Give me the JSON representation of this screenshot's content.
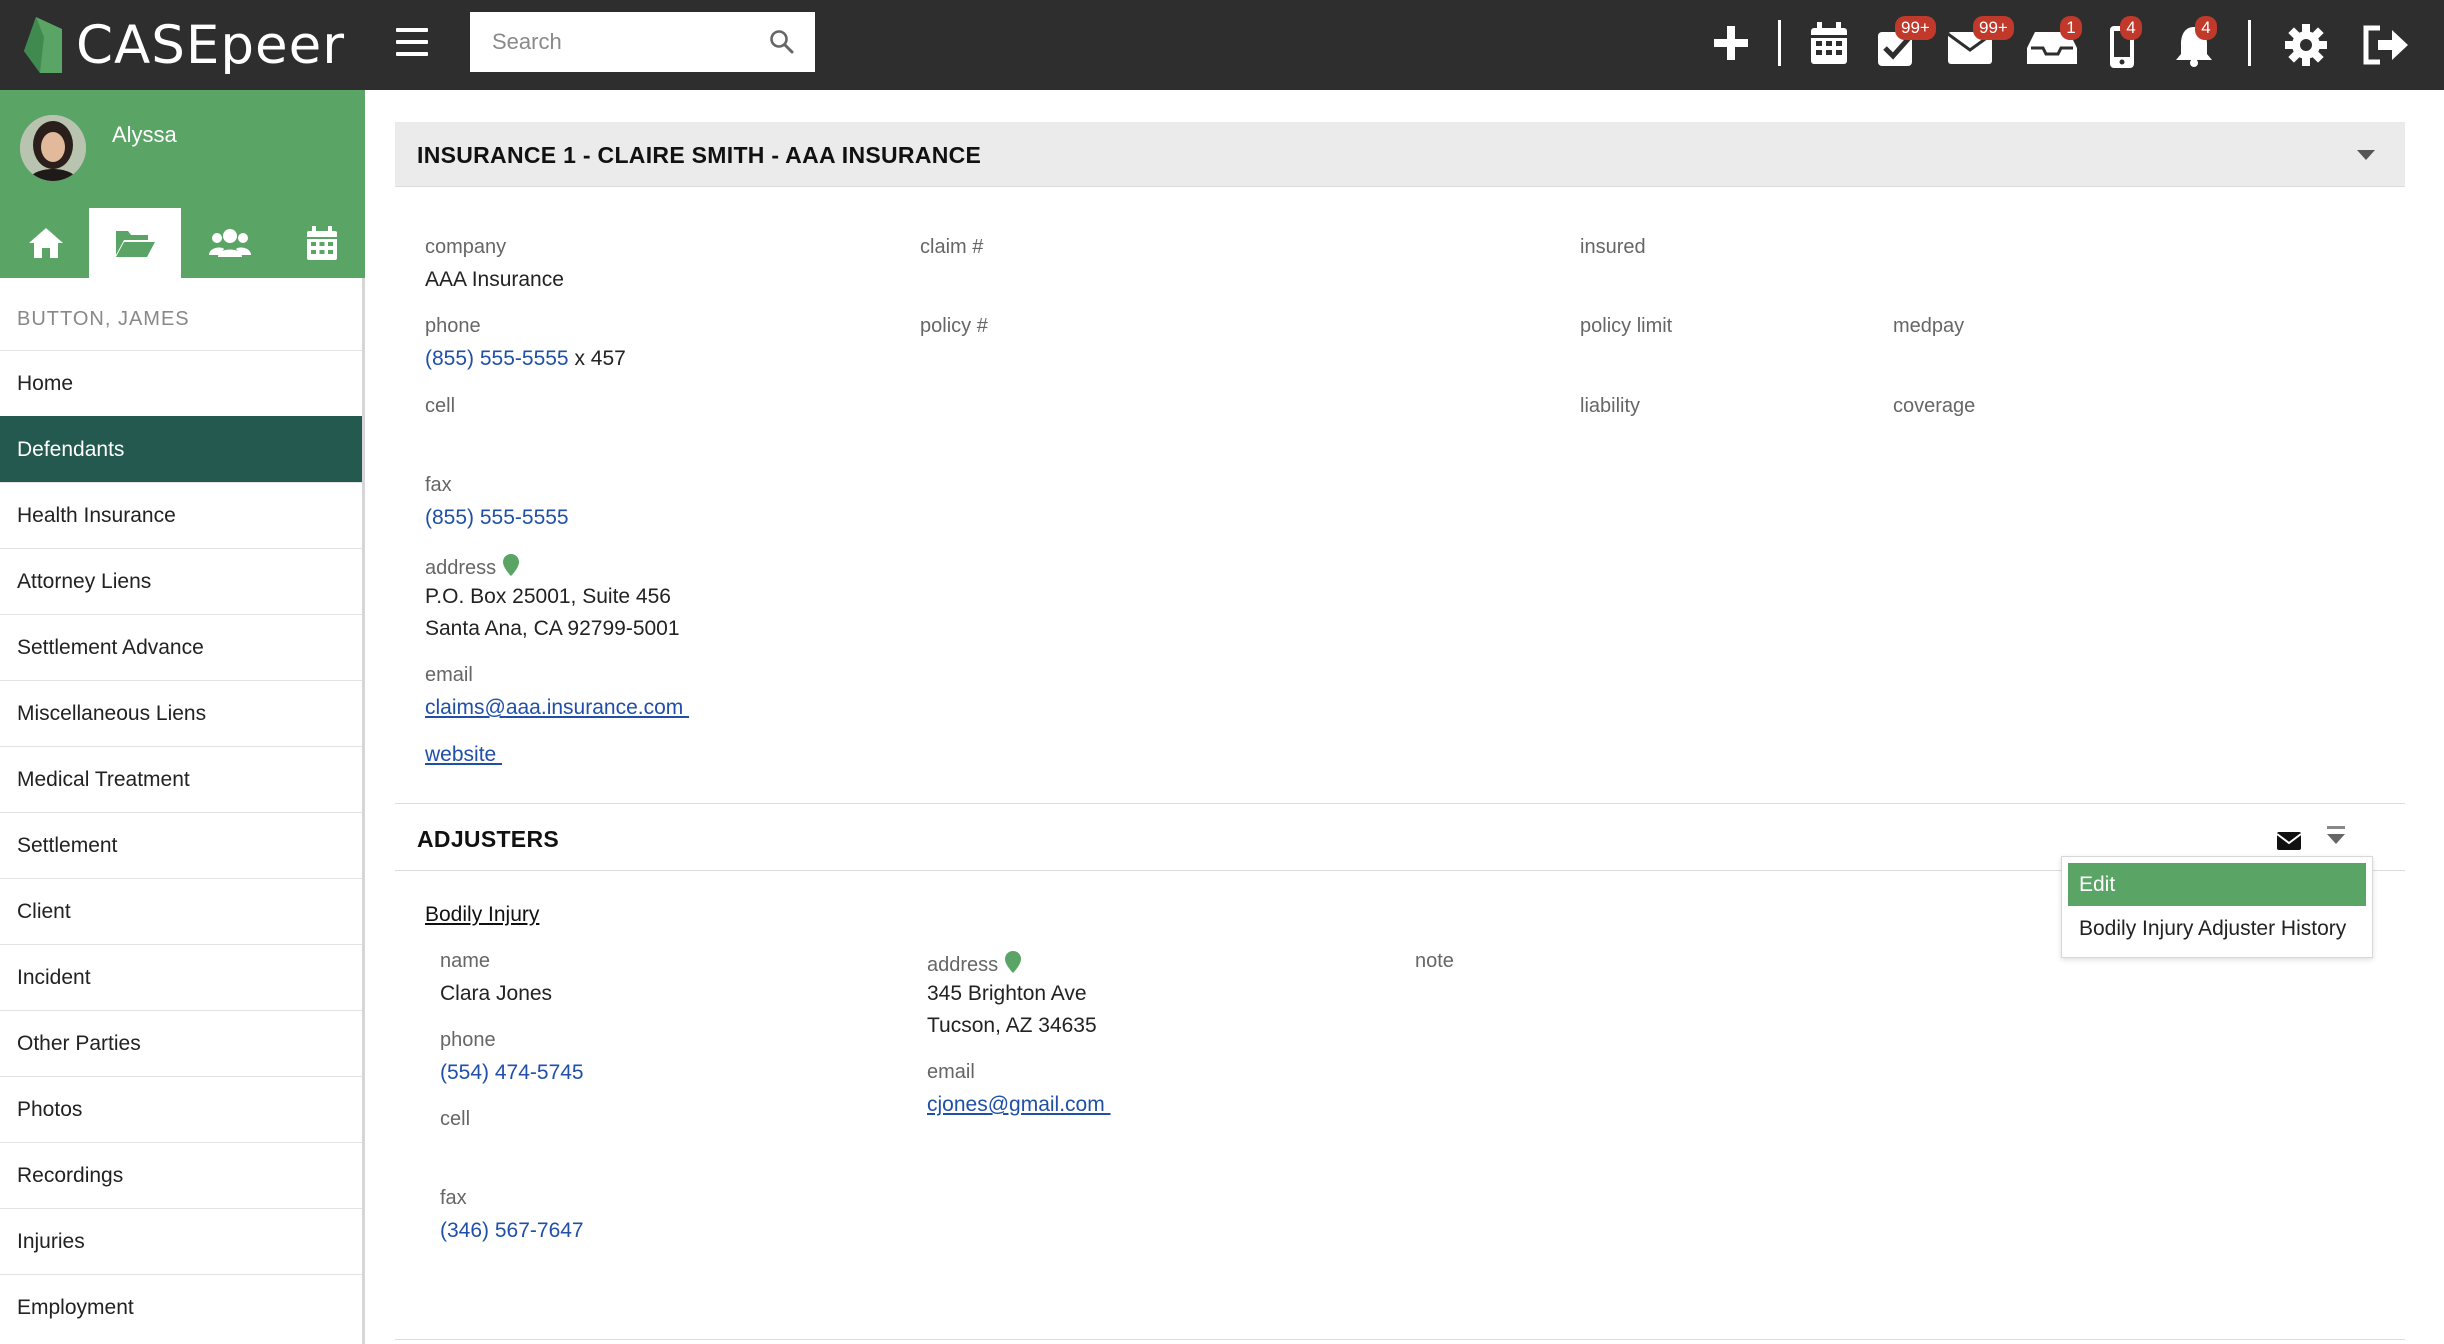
{
  "app": {
    "name": "CASEpeer"
  },
  "search": {
    "placeholder": "Search"
  },
  "toolbar": {
    "icons": [
      "plus-icon",
      "calendar-icon",
      "tasks-check-icon",
      "mail-icon",
      "inbox-tray-icon",
      "phone-icon",
      "bell-icon",
      "gear-icon",
      "logout-icon"
    ],
    "badges": {
      "tasks": "99+",
      "mail": "99+",
      "inbox": "1",
      "phone": "4",
      "bell": "4"
    }
  },
  "user": {
    "name": "Alyssa"
  },
  "nav_tabs": [
    "home-icon",
    "folder-open-icon",
    "users-icon",
    "calendar-icon"
  ],
  "case": {
    "name": "BUTTON, JAMES"
  },
  "sidebar": {
    "items": [
      {
        "label": "Home"
      },
      {
        "label": "Defendants"
      },
      {
        "label": "Health Insurance"
      },
      {
        "label": "Attorney Liens"
      },
      {
        "label": "Settlement Advance"
      },
      {
        "label": "Miscellaneous Liens"
      },
      {
        "label": "Medical Treatment"
      },
      {
        "label": "Settlement"
      },
      {
        "label": "Client"
      },
      {
        "label": "Incident"
      },
      {
        "label": "Other Parties"
      },
      {
        "label": "Photos"
      },
      {
        "label": "Recordings"
      },
      {
        "label": "Injuries"
      },
      {
        "label": "Employment"
      }
    ],
    "active": "Defendants"
  },
  "insurance": {
    "title": "INSURANCE 1 - CLAIRE SMITH - AAA INSURANCE",
    "labels": {
      "company": "company",
      "claim": "claim #",
      "insured": "insured",
      "phone": "phone",
      "policy": "policy #",
      "policy_limit": "policy limit",
      "medpay": "medpay",
      "cell": "cell",
      "liability": "liability",
      "coverage": "coverage",
      "fax": "fax",
      "address": "address",
      "email": "email",
      "website": "website "
    },
    "company": "AAA Insurance",
    "phone": "(855) 555-5555",
    "phone_ext": " x 457",
    "fax": "(855) 555-5555",
    "address_line1": "P.O. Box 25001, Suite 456",
    "address_line2": "Santa Ana, CA 92799-5001",
    "email": "claims@aaa.insurance.com "
  },
  "adjusters": {
    "title": "ADJUSTERS",
    "subtitle": "Bodily Injury",
    "labels": {
      "name": "name",
      "address": "address",
      "note": "note",
      "phone": "phone",
      "email": "email",
      "cell": "cell",
      "fax": "fax"
    },
    "name": "Clara Jones",
    "address_line1": "345 Brighton Ave",
    "address_line2": "Tucson, AZ 34635",
    "phone": "(554) 474-5745",
    "email": "cjones@gmail.com ",
    "fax": "(346) 567-7647"
  },
  "dropdown": {
    "items": [
      "Edit",
      "Bodily Injury Adjuster History"
    ],
    "active": "Edit"
  },
  "colors": {
    "topbar": "#2e2e2e",
    "brand_green": "#5aa466",
    "active_nav": "#23594f",
    "link": "#1f4fa8",
    "badge": "#c0392b"
  }
}
